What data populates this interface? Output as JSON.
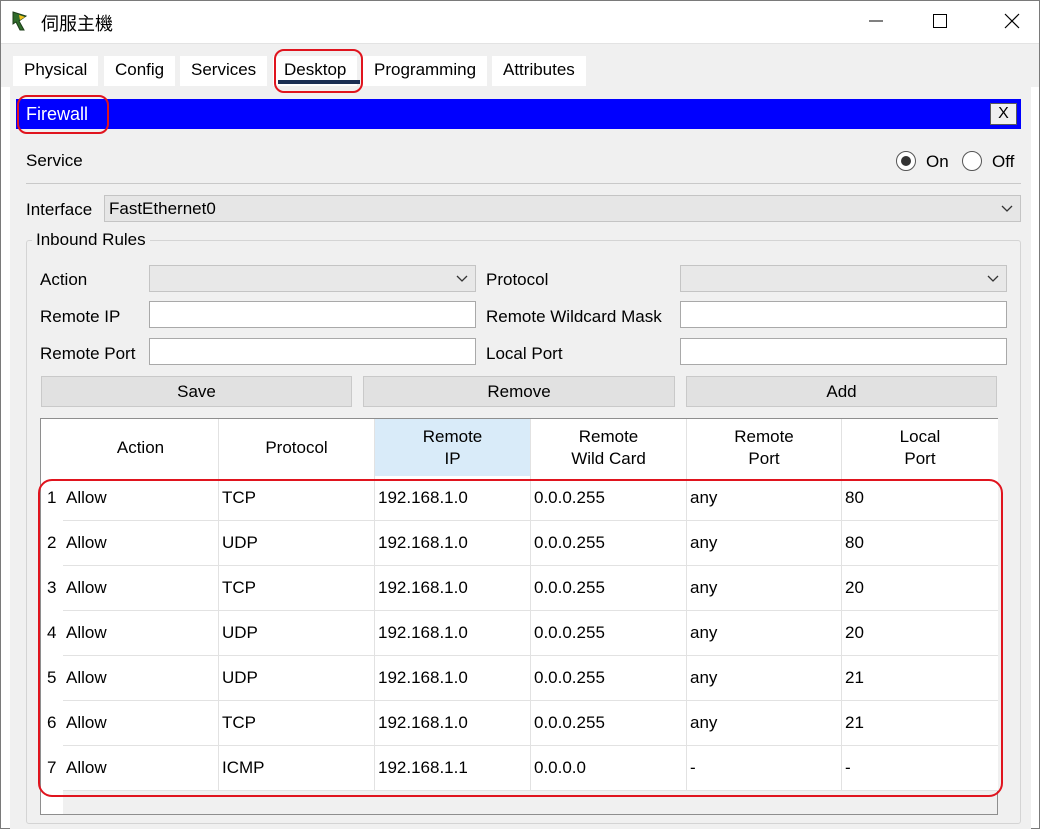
{
  "window": {
    "title": "伺服主機",
    "minimize_icon": "minimize-icon",
    "maximize_icon": "maximize-icon",
    "close_icon": "close-icon"
  },
  "tabs": [
    {
      "label": "Physical"
    },
    {
      "label": "Config"
    },
    {
      "label": "Services"
    },
    {
      "label": "Desktop",
      "active": true
    },
    {
      "label": "Programming"
    },
    {
      "label": "Attributes"
    }
  ],
  "firewall": {
    "title": "Firewall",
    "close_label": "X",
    "service": {
      "label": "Service",
      "on_label": "On",
      "off_label": "Off",
      "selected": "On"
    },
    "interface": {
      "label": "Interface",
      "value": "FastEthernet0"
    },
    "inbound": {
      "title": "Inbound Rules",
      "action_label": "Action",
      "action_value": "",
      "protocol_label": "Protocol",
      "protocol_value": "",
      "remote_ip_label": "Remote IP",
      "remote_ip_value": "",
      "remote_wildcard_label": "Remote Wildcard Mask",
      "remote_wildcard_value": "",
      "remote_port_label": "Remote Port",
      "remote_port_value": "",
      "local_port_label": "Local Port",
      "local_port_value": "",
      "save_label": "Save",
      "remove_label": "Remove",
      "add_label": "Add"
    },
    "table": {
      "headers": [
        {
          "l1": "Action",
          "l2": ""
        },
        {
          "l1": "Protocol",
          "l2": ""
        },
        {
          "l1": "Remote",
          "l2": "IP"
        },
        {
          "l1": "Remote",
          "l2": "Wild Card"
        },
        {
          "l1": "Remote",
          "l2": "Port"
        },
        {
          "l1": "Local",
          "l2": "Port"
        }
      ],
      "rows": [
        {
          "num": "1",
          "cells": [
            "Allow",
            "TCP",
            "192.168.1.0",
            "0.0.0.255",
            "any",
            "80"
          ]
        },
        {
          "num": "2",
          "cells": [
            "Allow",
            "UDP",
            "192.168.1.0",
            "0.0.0.255",
            "any",
            "80"
          ]
        },
        {
          "num": "3",
          "cells": [
            "Allow",
            "TCP",
            "192.168.1.0",
            "0.0.0.255",
            "any",
            "20"
          ]
        },
        {
          "num": "4",
          "cells": [
            "Allow",
            "UDP",
            "192.168.1.0",
            "0.0.0.255",
            "any",
            "20"
          ]
        },
        {
          "num": "5",
          "cells": [
            "Allow",
            "UDP",
            "192.168.1.0",
            "0.0.0.255",
            "any",
            "21"
          ]
        },
        {
          "num": "6",
          "cells": [
            "Allow",
            "TCP",
            "192.168.1.0",
            "0.0.0.255",
            "any",
            "21"
          ]
        },
        {
          "num": "7",
          "cells": [
            "Allow",
            "ICMP",
            "192.168.1.1",
            "0.0.0.0",
            "-",
            "-"
          ]
        }
      ]
    }
  },
  "colors": {
    "accent_bar": "#0000ff",
    "annotation": "#e0141e",
    "selected_header": "#d9ebf9"
  }
}
